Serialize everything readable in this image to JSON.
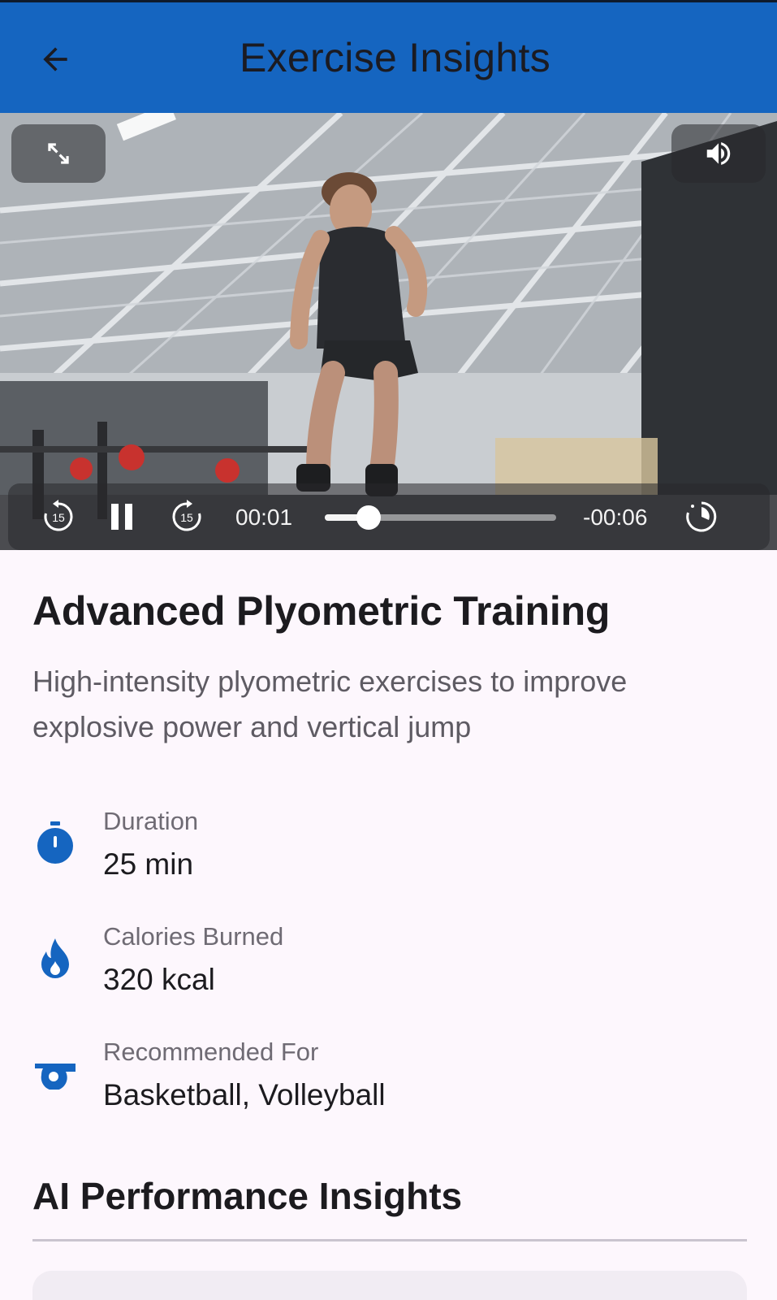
{
  "app_bar": {
    "title": "Exercise Insights",
    "back_icon": "arrow-back-icon",
    "background": "#1565c0"
  },
  "video": {
    "fullscreen_icon": "fullscreen-icon",
    "volume_icon": "volume-up-icon",
    "rewind_icon": "replay-15-icon",
    "rewind_label": "15",
    "pause_icon": "pause-icon",
    "forward_icon": "forward-15-icon",
    "forward_label": "15",
    "elapsed": "00:01",
    "remaining": "-00:06",
    "progress": 0.19,
    "speed_icon": "playback-speed-icon"
  },
  "exercise": {
    "title": "Advanced Plyometric Training",
    "description": "High-intensity plyometric exercises to improve explosive power and vertical jump"
  },
  "stats": [
    {
      "icon": "timer-icon",
      "label": "Duration",
      "value": "25 min"
    },
    {
      "icon": "flame-icon",
      "label": "Calories Burned",
      "value": "320 kcal"
    },
    {
      "icon": "whistle-icon",
      "label": "Recommended For",
      "value": "Basketball, Volleyball"
    }
  ],
  "insights": {
    "title": "AI Performance Insights"
  },
  "colors": {
    "accent": "#1565c0",
    "page_background": "#fdf7fd"
  }
}
